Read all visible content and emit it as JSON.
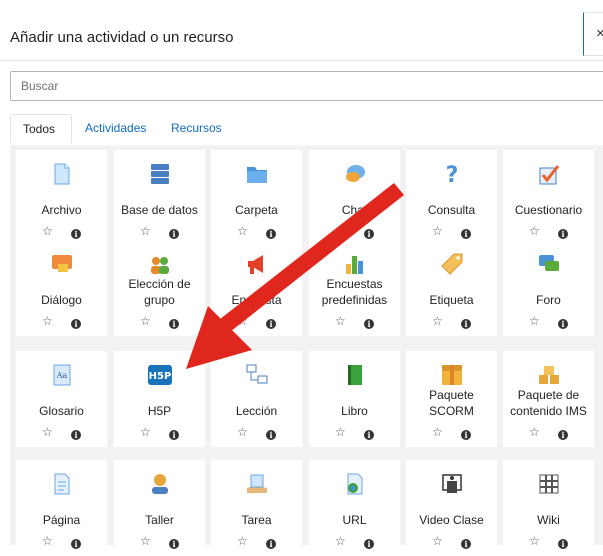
{
  "header": {
    "title": "Añadir una actividad o un recurso",
    "close_label": "×"
  },
  "search": {
    "placeholder": "Buscar"
  },
  "tabs": [
    {
      "label": "Todos"
    },
    {
      "label": "Actividades"
    },
    {
      "label": "Recursos"
    }
  ],
  "items": [
    {
      "label": "Archivo",
      "icon": "file-icon"
    },
    {
      "label": "Base de datos",
      "icon": "database-icon"
    },
    {
      "label": "Carpeta",
      "icon": "folder-icon"
    },
    {
      "label": "Chat",
      "icon": "chat-icon"
    },
    {
      "label": "Consulta",
      "icon": "question-icon"
    },
    {
      "label": "Cuestionario",
      "icon": "quiz-icon"
    },
    {
      "label": "Diálogo",
      "icon": "dialogue-icon"
    },
    {
      "label": "Elección de grupo",
      "icon": "group-choice-icon"
    },
    {
      "label": "Encuesta",
      "icon": "megaphone-icon"
    },
    {
      "label": "Encuestas predefinidas",
      "icon": "bar-chart-icon"
    },
    {
      "label": "Etiqueta",
      "icon": "tag-icon"
    },
    {
      "label": "Foro",
      "icon": "forum-icon"
    },
    {
      "label": "Glosario",
      "icon": "glossary-icon"
    },
    {
      "label": "H5P",
      "icon": "h5p-icon"
    },
    {
      "label": "Lección",
      "icon": "lesson-icon"
    },
    {
      "label": "Libro",
      "icon": "book-icon"
    },
    {
      "label": "Paquete SCORM",
      "icon": "scorm-icon"
    },
    {
      "label": "Paquete de contenido IMS",
      "icon": "ims-icon"
    },
    {
      "label": "Página",
      "icon": "page-icon"
    },
    {
      "label": "Taller",
      "icon": "workshop-icon"
    },
    {
      "label": "Tarea",
      "icon": "assignment-icon"
    },
    {
      "label": "URL",
      "icon": "url-icon"
    },
    {
      "label": "Video Clase",
      "icon": "video-class-icon"
    },
    {
      "label": "Wiki",
      "icon": "wiki-icon"
    }
  ],
  "card_actions": {
    "star_icon": "star-outline-icon",
    "info_icon": "info-icon"
  },
  "colors": {
    "accent": "#0f6cbf",
    "arrow": "#e0271e",
    "grid_bg": "#f2f2f2"
  }
}
